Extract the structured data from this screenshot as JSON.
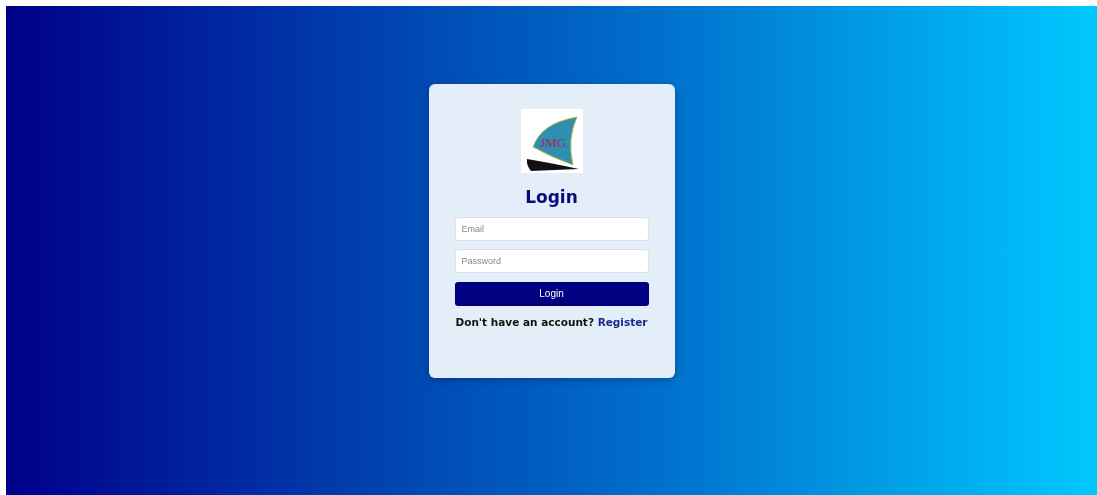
{
  "logo": {
    "text": "JMG"
  },
  "title": "Login",
  "fields": [
    {
      "placeholder": "Email"
    },
    {
      "placeholder": "Password"
    }
  ],
  "submit": "Login",
  "footer": {
    "text": "Don't have an account?",
    "link": "Register"
  }
}
